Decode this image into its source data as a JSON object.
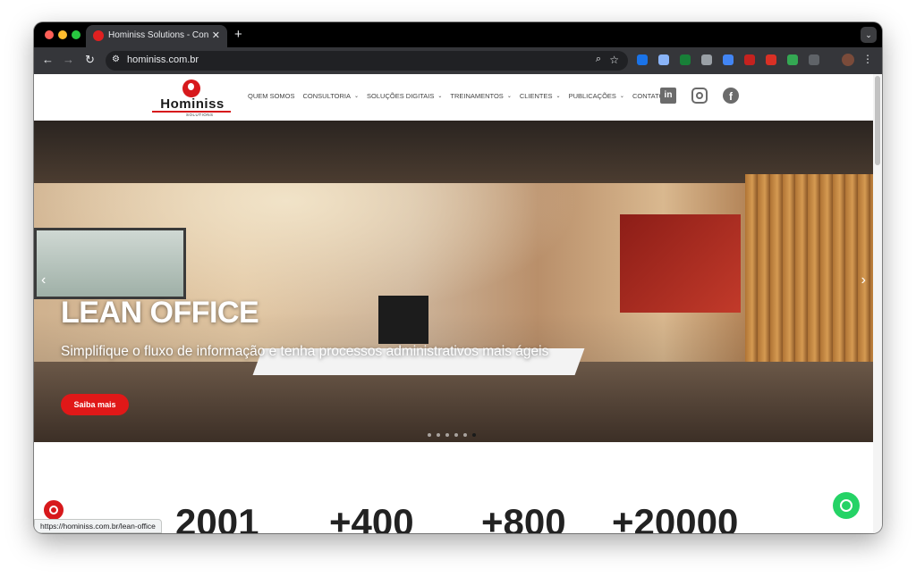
{
  "browser": {
    "tab": {
      "title": "Hominiss Solutions - Consult",
      "favicon": "hominiss-favicon-icon"
    },
    "address": {
      "url": "hominiss.com.br"
    },
    "status_url": "https://hominiss.com.br/lean-office",
    "icons": [
      "back-icon",
      "forward-icon",
      "reload-icon",
      "site-info-icon",
      "zoom-icon",
      "bookmark-star-icon",
      "extensions-icon",
      "kebab-menu-icon"
    ],
    "colors": {
      "frame": "#000000",
      "toolbar": "#35363a",
      "omnibox": "#202124"
    }
  },
  "site": {
    "logo": {
      "wordmark": "Hominiss",
      "sub": "SOLUTIONS"
    },
    "nav": [
      {
        "label": "QUEM SOMOS",
        "dropdown": false
      },
      {
        "label": "CONSULTORIA",
        "dropdown": true
      },
      {
        "label": "SOLUÇÕES DIGITAIS",
        "dropdown": true
      },
      {
        "label": "TREINAMENTOS",
        "dropdown": true
      },
      {
        "label": "CLIENTES",
        "dropdown": true
      },
      {
        "label": "PUBLICAÇÕES",
        "dropdown": true
      },
      {
        "label": "CONTATO",
        "dropdown": false
      }
    ],
    "social": {
      "linkedin": "in",
      "facebook": "f"
    },
    "accent": "#e01818"
  },
  "hero": {
    "title": "LEAN OFFICE",
    "subtitle": "Simplifique o fluxo de informação e tenha processos administrativos mais ágeis",
    "cta": "Saiba mais",
    "slides_total": 6,
    "active_slide": 6
  },
  "stats": [
    "2001",
    "+400",
    "+800",
    "+20000"
  ]
}
